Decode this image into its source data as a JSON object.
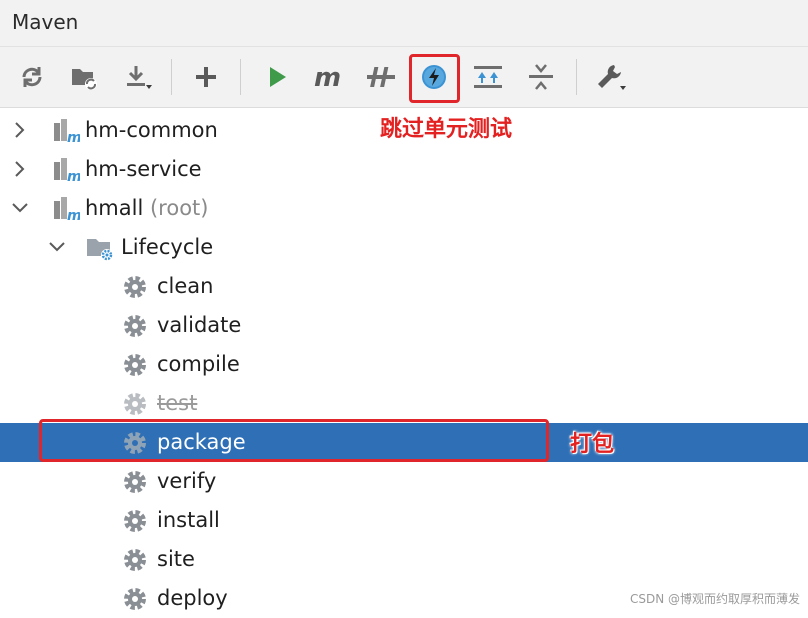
{
  "window": {
    "title": "Maven"
  },
  "toolbar": {
    "buttons": [
      {
        "icon": "reload-icon"
      },
      {
        "icon": "generate-sources-icon"
      },
      {
        "icon": "download-icon"
      },
      {
        "icon": "add-icon"
      },
      {
        "icon": "run-icon"
      },
      {
        "icon": "execute-goal-icon"
      },
      {
        "icon": "toggle-offline-icon"
      },
      {
        "icon": "skip-tests-icon"
      },
      {
        "icon": "expand-all-icon"
      },
      {
        "icon": "collapse-all-icon"
      },
      {
        "icon": "settings-wrench-icon"
      }
    ]
  },
  "annotations": {
    "skip_tests": "跳过单元测试",
    "package": "打包"
  },
  "tree": {
    "projects": [
      {
        "name": "hm-common",
        "suffix": "",
        "expanded": false
      },
      {
        "name": "hm-service",
        "suffix": "",
        "expanded": false
      },
      {
        "name": "hmall",
        "suffix": " (root)",
        "expanded": true
      }
    ],
    "lifecycle": {
      "label": "Lifecycle",
      "goals": [
        {
          "name": "clean",
          "skipped": false,
          "selected": false
        },
        {
          "name": "validate",
          "skipped": false,
          "selected": false
        },
        {
          "name": "compile",
          "skipped": false,
          "selected": false
        },
        {
          "name": "test",
          "skipped": true,
          "selected": false
        },
        {
          "name": "package",
          "skipped": false,
          "selected": true
        },
        {
          "name": "verify",
          "skipped": false,
          "selected": false
        },
        {
          "name": "install",
          "skipped": false,
          "selected": false
        },
        {
          "name": "site",
          "skipped": false,
          "selected": false
        },
        {
          "name": "deploy",
          "skipped": false,
          "selected": false
        }
      ]
    }
  },
  "colors": {
    "selection": "#2f6fb6",
    "annotation": "#e42121",
    "run_green": "#3f9b4a",
    "skip_tests_blue": "#3b93d3"
  },
  "watermark": "CSDN @博观而约取厚积而薄发"
}
